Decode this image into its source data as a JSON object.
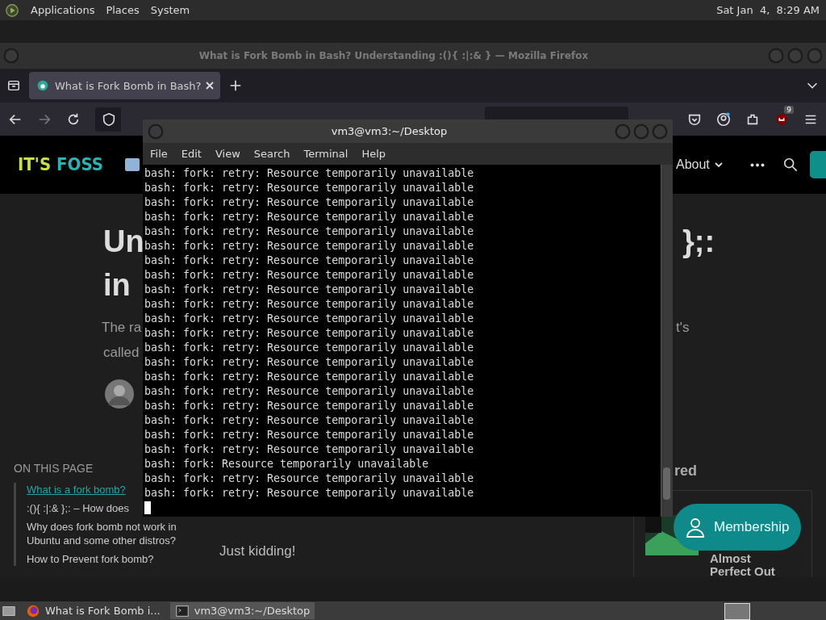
{
  "top_panel": {
    "menus": [
      "Applications",
      "Places",
      "System"
    ],
    "clock": "Sat Jan  4,  8:29 AM"
  },
  "browser": {
    "title": "What is Fork Bomb in Bash? Understanding :(){ :|:& } — Mozilla Firefox",
    "tabs": [
      {
        "label": "What is Fork Bomb in Bash?",
        "selected": true
      }
    ],
    "extension_badge": "9",
    "page": {
      "logo": [
        "IT'S",
        "FOSS"
      ],
      "nav_items": [
        "About"
      ],
      "heading_fragments": [
        "Un",
        "in",
        "};:"
      ],
      "intro_fragments": [
        "The ra",
        "called",
        "t's"
      ],
      "toc_title": "ON THIS PAGE",
      "toc": [
        {
          "label": "What is a fork bomb?",
          "selected": true
        },
        {
          "label": ":(){ :|:& };: – How does",
          "selected": false
        },
        {
          "label": "Why does fork bomb not work in Ubuntu and some other distros?",
          "selected": false
        },
        {
          "label": "How to Prevent fork bomb?",
          "selected": false
        }
      ],
      "body_text": "Just kidding!",
      "sidebar_heading": "red",
      "card_title": [
        "Almost",
        "Perfect Out"
      ],
      "membership_button": "Membership"
    }
  },
  "terminal": {
    "title": "vm3@vm3:~/Desktop",
    "menus": [
      "File",
      "Edit",
      "View",
      "Search",
      "Terminal",
      "Help"
    ],
    "lines": [
      "bash: fork: retry: Resource temporarily unavailable",
      "bash: fork: retry: Resource temporarily unavailable",
      "bash: fork: retry: Resource temporarily unavailable",
      "bash: fork: retry: Resource temporarily unavailable",
      "bash: fork: retry: Resource temporarily unavailable",
      "bash: fork: retry: Resource temporarily unavailable",
      "bash: fork: retry: Resource temporarily unavailable",
      "bash: fork: retry: Resource temporarily unavailable",
      "bash: fork: retry: Resource temporarily unavailable",
      "bash: fork: retry: Resource temporarily unavailable",
      "bash: fork: retry: Resource temporarily unavailable",
      "bash: fork: retry: Resource temporarily unavailable",
      "bash: fork: retry: Resource temporarily unavailable",
      "bash: fork: retry: Resource temporarily unavailable",
      "bash: fork: retry: Resource temporarily unavailable",
      "bash: fork: retry: Resource temporarily unavailable",
      "bash: fork: retry: Resource temporarily unavailable",
      "bash: fork: retry: Resource temporarily unavailable",
      "bash: fork: retry: Resource temporarily unavailable",
      "bash: fork: retry: Resource temporarily unavailable",
      "bash: fork: Resource temporarily unavailable",
      "bash: fork: retry: Resource temporarily unavailable",
      "bash: fork: retry: Resource temporarily unavailable"
    ]
  },
  "taskbar": {
    "items": [
      {
        "kind": "browser",
        "label": "What is Fork Bomb i...",
        "selected": false
      },
      {
        "kind": "terminal",
        "label": "vm3@vm3:~/Desktop",
        "selected": true
      }
    ]
  }
}
